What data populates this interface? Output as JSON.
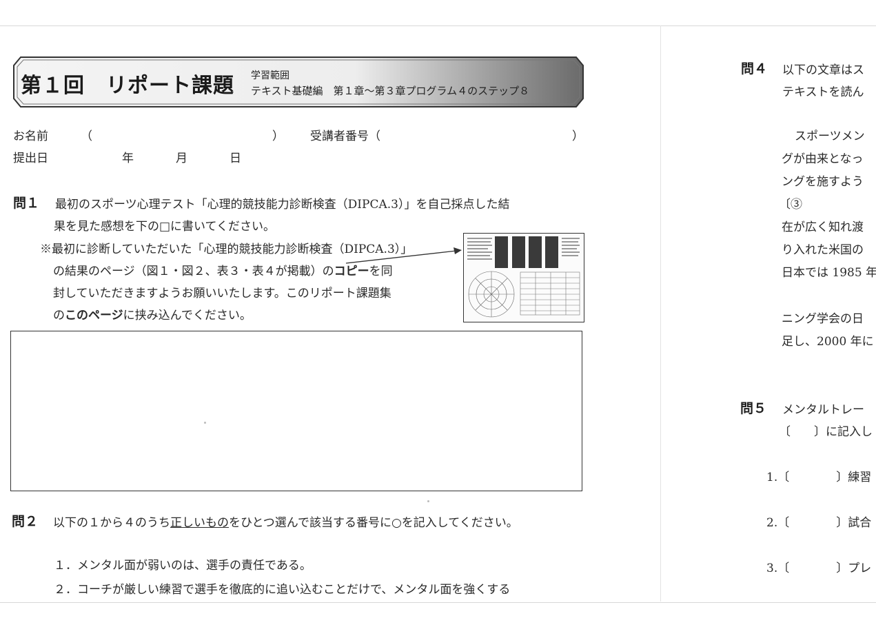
{
  "banner": {
    "title": "第１回　リポート課題",
    "range_label": "学習範囲",
    "range": "テキスト基礎編　第１章〜第３章プログラム４のステップ８"
  },
  "form": {
    "name_label": "お名前",
    "name_open": "（",
    "name_close": "）",
    "student_id_label": "受講者番号（",
    "student_id_close": "）",
    "date_label": "提出日",
    "year": "年",
    "month": "月",
    "day": "日"
  },
  "q1": {
    "label": "問１",
    "line1": "最初のスポーツ心理テスト「心理的競技能力診断検査（DIPCA.3）」を自己採点した結",
    "line2": "果を見た感想を下の□に書いてください。",
    "note1": "※最初に診断していただいた「心理的競技能力診断検査（DIPCA.3）」",
    "note2a": "の結果のページ（図１・図２、表３・表４が掲載）の",
    "note2b": "コピー",
    "note2c": "を同",
    "note3": "封していただきますようお願いいたします。このリポート課題集",
    "note4a": "の",
    "note4b": "このページ",
    "note4c": "に挟み込んでください。"
  },
  "q2": {
    "label": "問２",
    "line_a": "以下の１から４のうち",
    "line_b": "正しいもの",
    "line_c": "をひとつ選んで該当する番号に○を記入してください。",
    "options": [
      "１．メンタル面が弱いのは、選手の責任である。",
      "２．コーチが厳しい練習で選手を徹底的に追い込むことだけで、メンタル面を強くする"
    ]
  },
  "right": {
    "q4_label": "問４",
    "q4_line1": "以下の文章はス",
    "q4_line2": "テキストを読ん",
    "p1": "スポーツメン",
    "p2": "グが由来となっ",
    "p3": "ングを施すよう",
    "p4": "〔③",
    "p5": "在が広く知れ渡",
    "p6": "り入れた米国の",
    "p7": "日本では 1985 年",
    "p8": "ニング学会の日",
    "p9": "足し、2000 年に",
    "q5_label": "問５",
    "q5_line1": "メンタルトレー",
    "q5_line2": "〔　　〕に記入し",
    "items": [
      {
        "num": "1.",
        "bracket": "〔　　　　〕",
        "text": "練習"
      },
      {
        "num": "2.",
        "bracket": "〔　　　　〕",
        "text": "試合"
      },
      {
        "num": "3.",
        "bracket": "〔　　　　〕",
        "text": "プレ"
      }
    ]
  }
}
